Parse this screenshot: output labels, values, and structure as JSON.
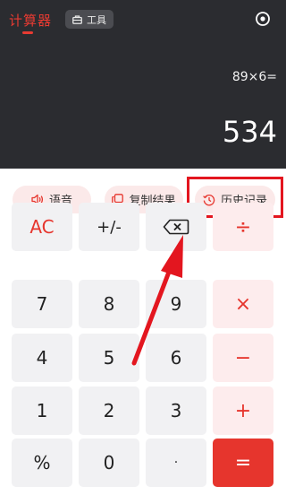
{
  "header": {
    "app_title": "计算器",
    "tools_tab_label": "工具"
  },
  "display": {
    "expression": "89×6=",
    "result": "534"
  },
  "actions": {
    "voice_label": "语音",
    "copy_label": "复制结果",
    "history_label": "历史记录"
  },
  "keys": {
    "ac": "AC",
    "sign": "+/-",
    "divide": "÷",
    "seven": "7",
    "eight": "8",
    "nine": "9",
    "multiply": "×",
    "four": "4",
    "five": "5",
    "six": "6",
    "minus": "−",
    "one": "1",
    "two": "2",
    "three": "3",
    "plus": "+",
    "percent": "%",
    "zero": "0",
    "dot": "·",
    "equals": "="
  },
  "colors": {
    "accent": "#e6352d",
    "display_bg": "#2b2c30",
    "key_bg": "#f1f1f3",
    "operator_bg": "#fdeced",
    "annotation": "#e3161f"
  },
  "icons": {
    "settings": "gear-icon",
    "tools": "toolbox-icon",
    "voice": "speaker-icon",
    "copy": "copy-icon",
    "history": "clock-icon",
    "backspace": "backspace-icon"
  }
}
